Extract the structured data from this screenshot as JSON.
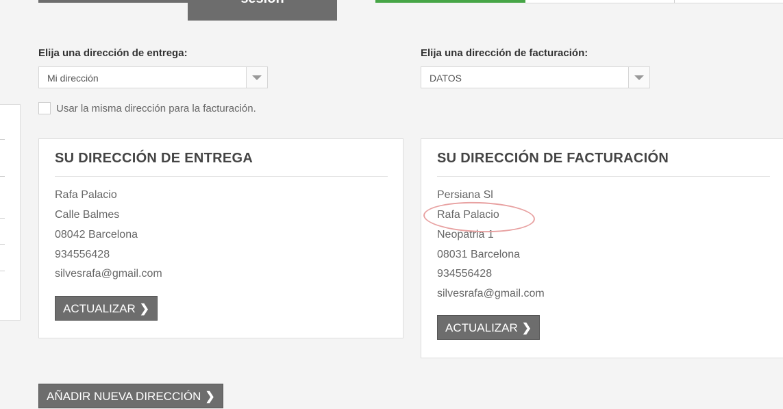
{
  "steps": {
    "active_label": "sesión"
  },
  "delivery": {
    "select_label": "Elija una dirección de entrega:",
    "select_value": "Mi dirección",
    "same_address_label": "Usar la misma dirección para la facturación.",
    "card_title": "SU DIRECCIÓN DE ENTREGA",
    "lines": [
      "Rafa Palacio",
      "Calle Balmes",
      "08042 Barcelona",
      "934556428",
      "silvesrafa@gmail.com"
    ],
    "update_label": "ACTUALIZAR"
  },
  "billing": {
    "select_label": "Elija una dirección de facturación:",
    "select_value": "DATOS",
    "card_title": "SU DIRECCIÓN DE FACTURACIÓN",
    "lines": [
      "Persiana Sl",
      "Rafa Palacio",
      "Neopatria 1",
      "08031 Barcelona",
      "934556428",
      "silvesrafa@gmail.com"
    ],
    "update_label": "ACTUALIZAR"
  },
  "add_address_label": "AÑADIR NUEVA DIRECCIÓN",
  "icons": {
    "chevron": "chevron-right-icon",
    "dropdown": "chevron-down-icon"
  },
  "colors": {
    "step_done": "#6d6d6d",
    "step_active": "#46a546",
    "button": "#6d6d6d",
    "annotation": "#e8a2a2"
  }
}
